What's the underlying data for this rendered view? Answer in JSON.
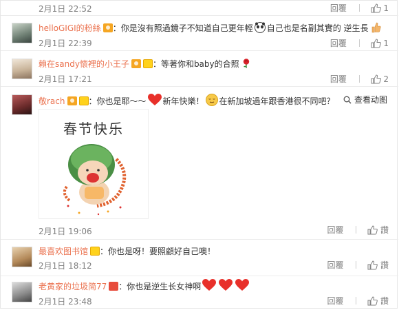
{
  "comments": [
    {
      "time": "2月1日 22:52",
      "reply_label": "回覆",
      "like_count": "1"
    },
    {
      "name": "helloGIGI的粉絲",
      "text": "：你是沒有照過鏡子不知道自己更年輕",
      "text2": "自己也是名副其實的 逆生長",
      "time": "2月1日 22:39",
      "reply_label": "回覆",
      "like_count": "1"
    },
    {
      "name": "賴在sandy懷裡的小王子",
      "text": "：等著你和baby的合照",
      "time": "2月1日 17:21",
      "reply_label": "回覆",
      "like_count": "2"
    },
    {
      "name": "敬rach",
      "text": "：你也是耶～～",
      "text2": "新年快樂！",
      "text3": "在新加坡過年跟香港很不同吧？",
      "view_gif_label": "查看动图",
      "gif_caption": "春节快乐",
      "time": "2月1日 19:06",
      "reply_label": "回覆",
      "like_label": "讚"
    },
    {
      "name": "最喜欢图书馆",
      "text": "：你也是呀！要照顧好自己噢！",
      "time": "2月1日 18:12",
      "reply_label": "回覆",
      "like_label": "讚"
    },
    {
      "name": "老黄家的垃圾简77",
      "text": "：你也是逆生长女神啊",
      "time": "2月1日 23:48",
      "reply_label": "回覆",
      "like_label": "讚"
    }
  ],
  "colors": {
    "name": "#eb7350",
    "muted": "#808080",
    "heart": "#e8302a"
  }
}
